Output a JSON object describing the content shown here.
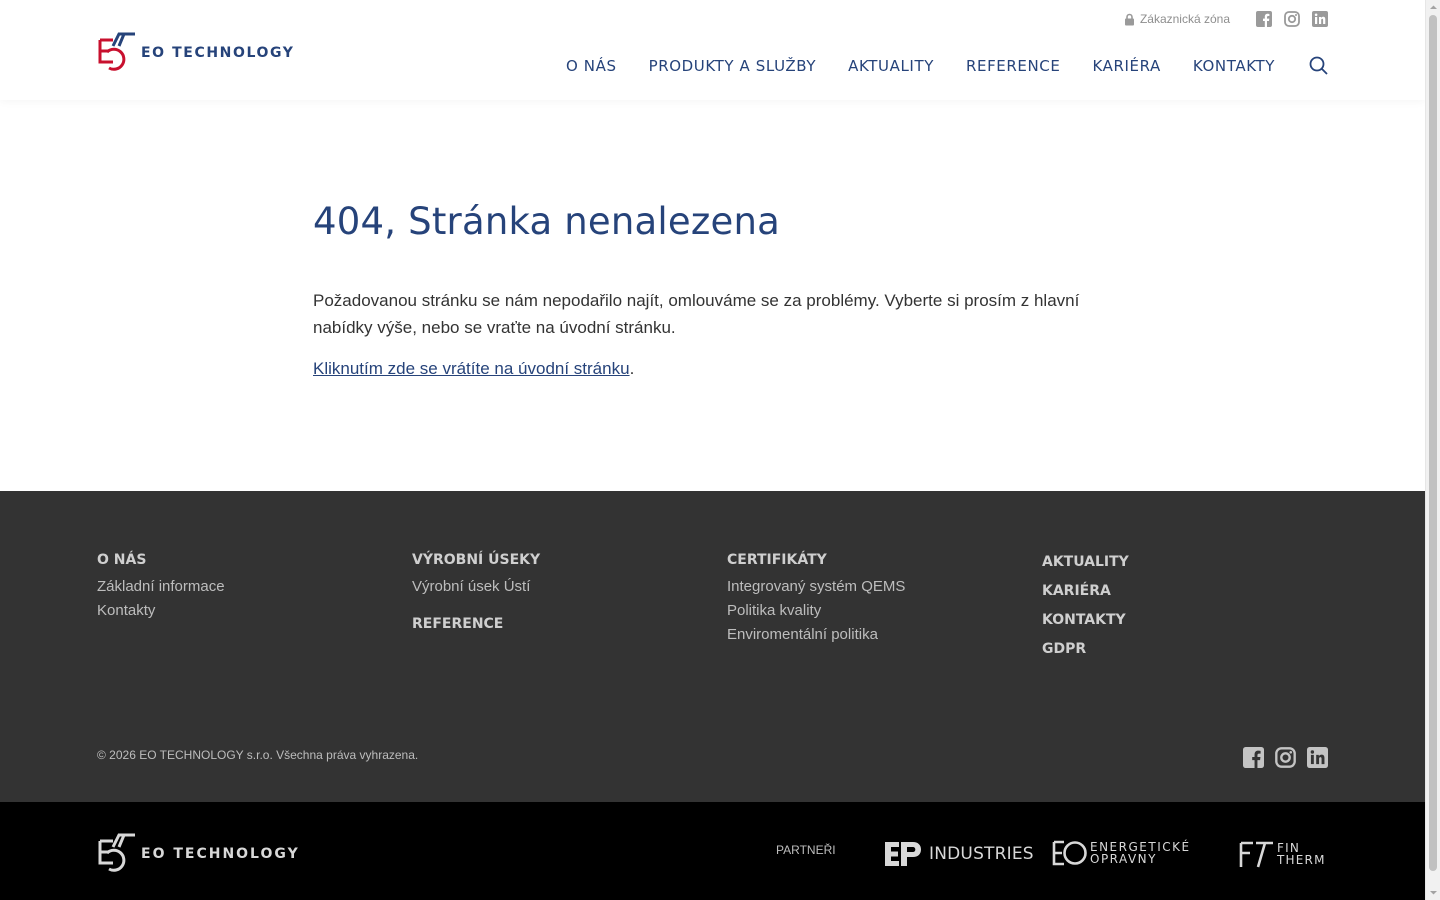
{
  "brand": {
    "name": "EO TECHNOLOGY",
    "colors": {
      "primary": "#26437a",
      "accent": "#c8102e",
      "footer_bg": "#333333",
      "bottom_bg": "#000000"
    }
  },
  "header": {
    "customer_zone": "Zákaznická zóna",
    "nav": [
      "O NÁS",
      "PRODUKTY A SLUŽBY",
      "AKTUALITY",
      "REFERENCE",
      "KARIÉRA",
      "KONTAKTY"
    ],
    "icons": [
      "lock-icon",
      "facebook-icon",
      "instagram-icon",
      "linkedin-icon",
      "search-icon"
    ]
  },
  "main": {
    "title": "404, Stránka nenalezena",
    "description": "Požadovanou stránku se nám nepodařilo najít, omlouváme se za problémy. Vyberte si prosím z hlavní nabídky výše, nebo se vraťte na úvodní stránku.",
    "back_link": "Kliknutím zde se vrátíte na úvodní stránku",
    "back_suffix": "."
  },
  "footer": {
    "col1": {
      "heading": "O NÁS",
      "links": [
        "Základní informace",
        "Kontakty"
      ]
    },
    "col2": {
      "heading": "VÝROBNÍ ÚSEKY",
      "links": [
        "Výrobní úsek Ústí"
      ],
      "heading2": "REFERENCE"
    },
    "col3": {
      "heading": "CERTIFIKÁTY",
      "links": [
        "Integrovaný systém QEMS",
        "Politika kvality",
        "Enviromentální politika"
      ]
    },
    "col4": {
      "headings": [
        "AKTUALITY",
        "KARIÉRA",
        "KONTAKTY",
        "GDPR"
      ]
    },
    "copyright": "© 2026 EO TECHNOLOGY s.r.o. Všechna práva vyhrazena."
  },
  "bottom": {
    "brand": "EO TECHNOLOGY",
    "partners_label": "PARTNEŘI",
    "partners": {
      "industries": "INDUSTRIES",
      "energeticke_line1": "ENERGETICKÉ",
      "energeticke_line2": "OPRAVNY",
      "fintherm_line1": "FIN",
      "fintherm_line2": "THERM"
    }
  }
}
